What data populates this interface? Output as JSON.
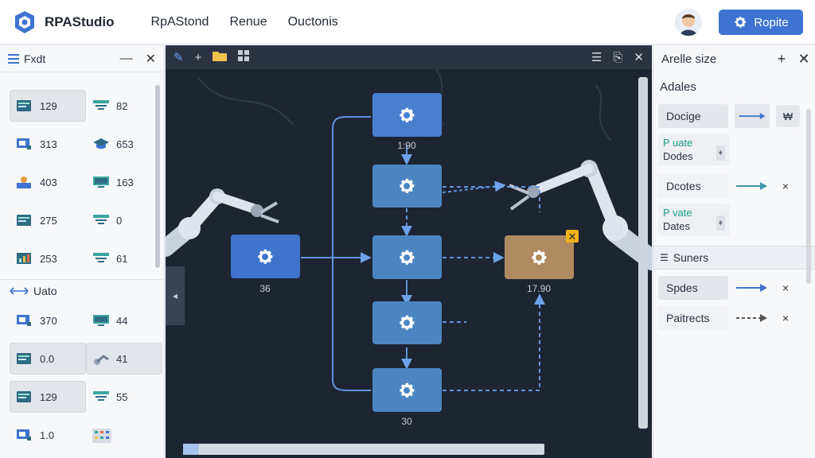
{
  "header": {
    "app_name": "RPAStudio",
    "menu": [
      "RpAStond",
      "Renue",
      "Ouctonis"
    ],
    "primary_button": "Ropite",
    "brand_color": "#3e73d1"
  },
  "left_panel": {
    "title": "Fxdt",
    "tiles": [
      {
        "value": "129",
        "icon": "window-icon",
        "selected": true
      },
      {
        "value": "82",
        "icon": "toolbar-icon",
        "selected": false
      },
      {
        "value": "313",
        "icon": "monitor-icon",
        "selected": false
      },
      {
        "value": "653",
        "icon": "graduation-cap-icon",
        "selected": false
      },
      {
        "value": "403",
        "icon": "user-icon",
        "selected": false
      },
      {
        "value": "163",
        "icon": "screen-icon",
        "selected": false
      },
      {
        "value": "275",
        "icon": "window-icon",
        "selected": false
      },
      {
        "value": "0",
        "icon": "toolbar-icon",
        "selected": false
      },
      {
        "value": "253",
        "icon": "chart-window-icon",
        "selected": false
      },
      {
        "value": "61",
        "icon": "toolbar-icon",
        "selected": false
      }
    ],
    "section_title": "Uato",
    "section_tiles": [
      {
        "value": "370",
        "icon": "monitor-icon",
        "selected": false
      },
      {
        "value": "44",
        "icon": "screen-icon",
        "selected": false
      },
      {
        "value": "0.0",
        "icon": "window-icon",
        "selected": true
      },
      {
        "value": "41",
        "icon": "robot-arm-icon",
        "selected": true
      },
      {
        "value": "129",
        "icon": "window-icon",
        "selected": true
      },
      {
        "value": "55",
        "icon": "toolbar-icon",
        "selected": false
      },
      {
        "value": "1.0",
        "icon": "monitor-icon",
        "selected": false
      },
      {
        "value": "",
        "icon": "grid-icon",
        "selected": false
      }
    ]
  },
  "canvas": {
    "nodes": [
      {
        "id": "n-top",
        "label": "1:90",
        "color": "#4a7fd0"
      },
      {
        "id": "n-2",
        "label": "",
        "color": "#4c86c2"
      },
      {
        "id": "n-left",
        "label": "36",
        "color": "#3f73cc"
      },
      {
        "id": "n-center",
        "label": "",
        "color": "#4c86c2"
      },
      {
        "id": "n-right",
        "label": "17.90",
        "color": "#b08a60"
      },
      {
        "id": "n-4",
        "label": "",
        "color": "#4c86c2"
      },
      {
        "id": "n-bottom",
        "label": "30",
        "color": "#4c86c2"
      }
    ]
  },
  "right_panel": {
    "title": "Arelle size",
    "subtitle": "Adales",
    "rows": [
      {
        "label": "Docige",
        "kind": "pill",
        "arrow": "solid",
        "action": "₩"
      },
      {
        "label_line1": "P uate",
        "label_line2": "Dodes",
        "kind": "note"
      },
      {
        "label": "Dcotes",
        "kind": "plain",
        "arrow": "solid-teal",
        "action": "×"
      },
      {
        "label_line1": "P vate",
        "label_line2": "Dates",
        "kind": "note"
      }
    ],
    "section_title": "Suners",
    "section_rows": [
      {
        "label": "Spdes",
        "arrow": "solid",
        "action": "×"
      },
      {
        "label": "Paitrects",
        "arrow": "dashed",
        "action": "×"
      }
    ]
  }
}
